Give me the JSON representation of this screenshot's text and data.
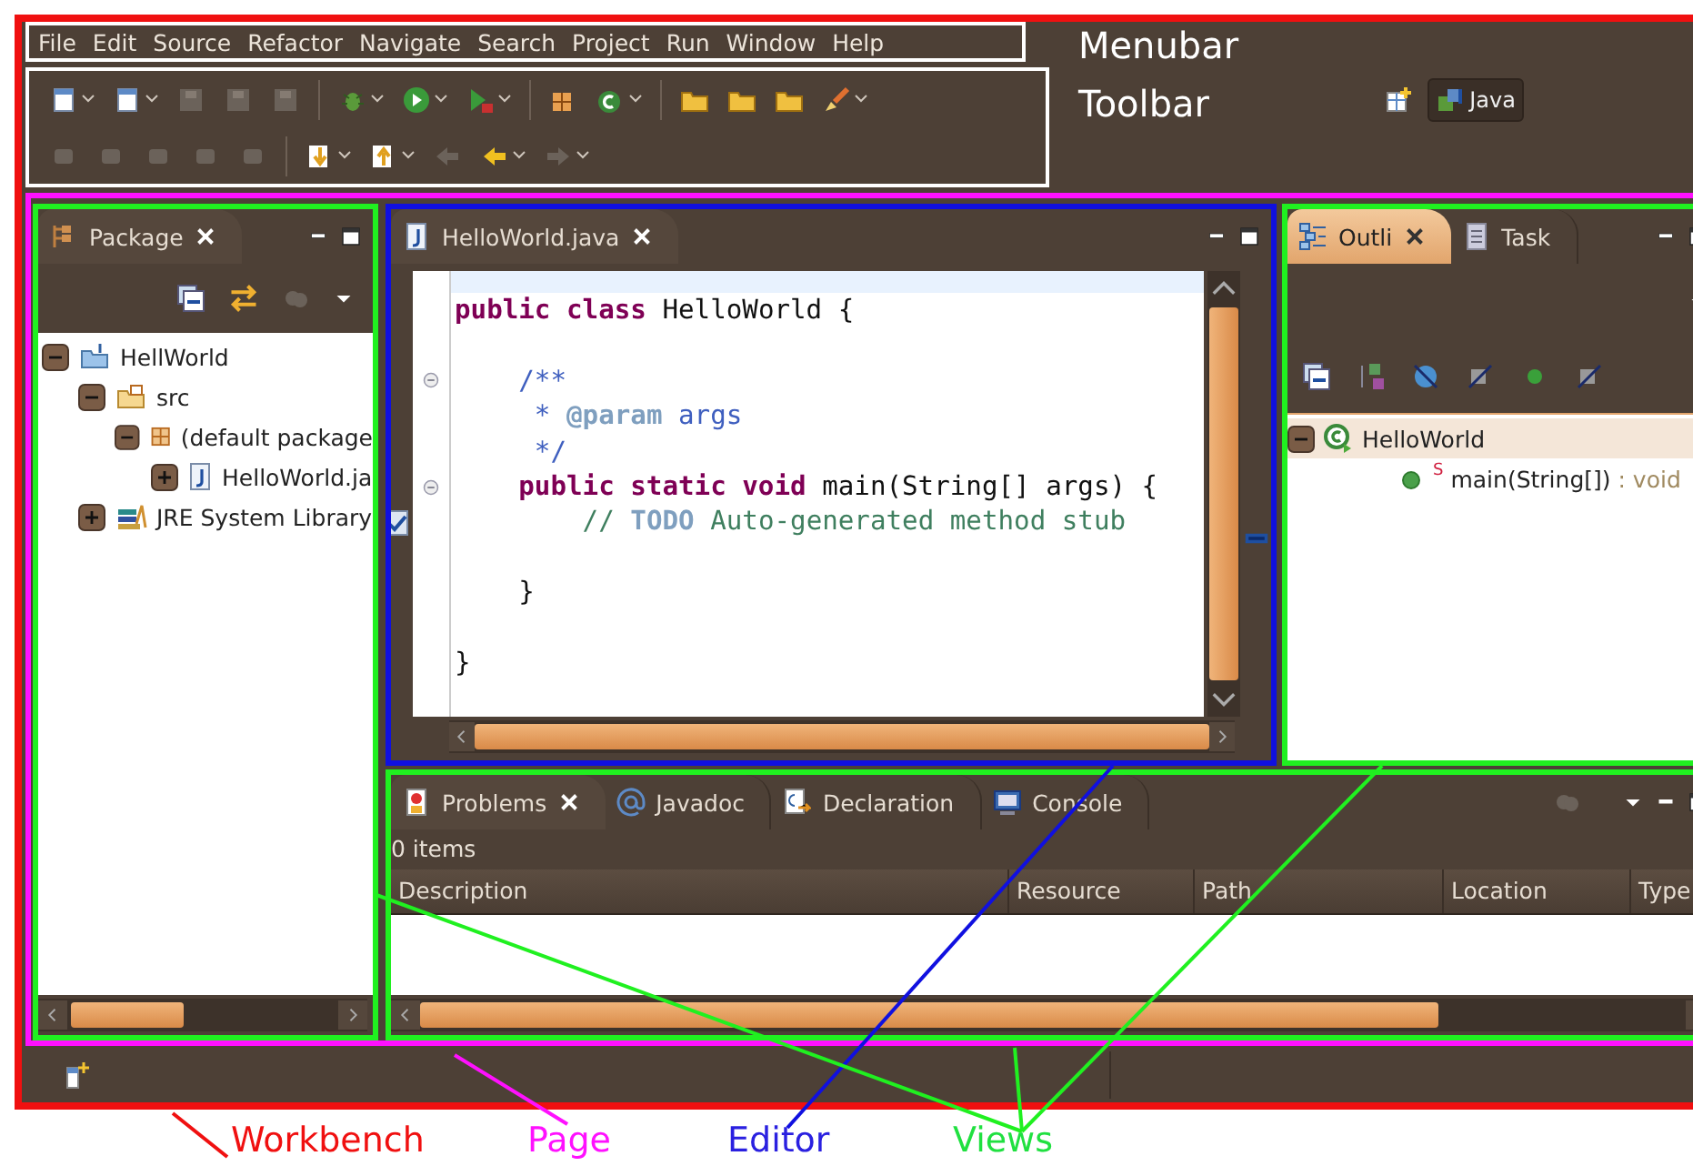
{
  "menubar": {
    "items": [
      "File",
      "Edit",
      "Source",
      "Refactor",
      "Navigate",
      "Search",
      "Project",
      "Run",
      "Window",
      "Help"
    ]
  },
  "perspective": {
    "label": "Java",
    "selected": true
  },
  "package_view": {
    "active": false,
    "tab": {
      "label": "Package",
      "selected": true
    },
    "tree": [
      {
        "label": "HellWorld",
        "kind": "project",
        "expanded": true,
        "children": [
          {
            "label": "src",
            "kind": "folder",
            "expanded": true,
            "children": [
              {
                "label": "(default package",
                "kind": "package",
                "expanded": true,
                "children": [
                  {
                    "label": "HelloWorld.ja",
                    "kind": "file",
                    "expanded": false
                  }
                ]
              }
            ]
          },
          {
            "label": "JRE System Library",
            "kind": "library",
            "expanded": false
          }
        ]
      }
    ]
  },
  "editor": {
    "tab": {
      "label": "HelloWorld.java",
      "selected": true
    },
    "lines": [
      {
        "kind": "blank",
        "current": true
      },
      {
        "kind": "code",
        "segments": [
          {
            "kind": "keyword",
            "text": "public class"
          },
          {
            "kind": "plain",
            "text": " HelloWorld {"
          }
        ]
      },
      {
        "kind": "blank",
        "current": false
      },
      {
        "kind": "code",
        "fold": true,
        "segments": [
          {
            "kind": "javadoc",
            "text": "    /**"
          }
        ]
      },
      {
        "kind": "code",
        "segments": [
          {
            "kind": "javadoc",
            "text": "     * "
          },
          {
            "kind": "tag",
            "text": "@param"
          },
          {
            "kind": "javadoc",
            "text": " args"
          }
        ]
      },
      {
        "kind": "code",
        "segments": [
          {
            "kind": "javadoc",
            "text": "     */"
          }
        ]
      },
      {
        "kind": "code",
        "fold": true,
        "segments": [
          {
            "kind": "keyword",
            "text": "    public static void"
          },
          {
            "kind": "plain",
            "text": " main(String[] args) {"
          }
        ]
      },
      {
        "kind": "code",
        "task": true,
        "segments": [
          {
            "kind": "comment",
            "text": "        // "
          },
          {
            "kind": "todo",
            "text": "TODO"
          },
          {
            "kind": "comment",
            "text": " Auto-generated method stub"
          }
        ]
      },
      {
        "kind": "blank",
        "current": false
      },
      {
        "kind": "code",
        "segments": [
          {
            "kind": "plain",
            "text": "    }"
          }
        ]
      },
      {
        "kind": "blank",
        "current": false
      },
      {
        "kind": "code",
        "segments": [
          {
            "kind": "plain",
            "text": "}"
          }
        ]
      }
    ]
  },
  "outline_view": {
    "active": true,
    "tabs": [
      {
        "label": "Outli",
        "selected": true
      },
      {
        "label": "Task",
        "selected": false
      }
    ],
    "tree": [
      {
        "label": "HelloWorld",
        "kind": "class",
        "expanded": true,
        "selected": true,
        "children": [
          {
            "label": "main(String[])",
            "kind": "method",
            "modifier": "S",
            "type": " : void",
            "selected": false
          }
        ]
      }
    ]
  },
  "bottom_view": {
    "tabs": [
      {
        "label": "Problems",
        "selected": true
      },
      {
        "label": "Javadoc",
        "selected": false
      },
      {
        "label": "Declaration",
        "selected": false
      },
      {
        "label": "Console",
        "selected": false
      }
    ],
    "summary": "0 items",
    "columns": [
      "Description",
      "Resource",
      "Path",
      "Location",
      "Type"
    ]
  },
  "annotations": {
    "menubar": "Menubar",
    "toolbar": "Toolbar",
    "workbench": "Workbench",
    "page": "Page",
    "editor": "Editor",
    "views": "Views"
  }
}
